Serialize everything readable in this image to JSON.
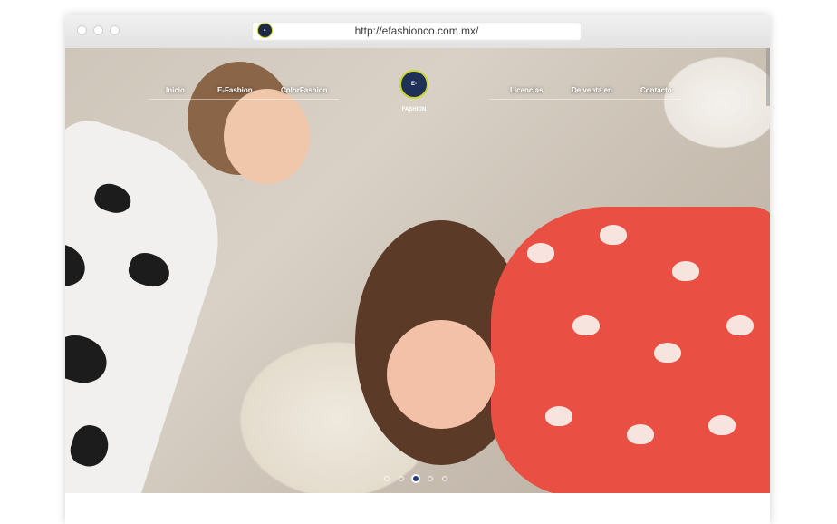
{
  "browser": {
    "url": "http://efashionco.com.mx/",
    "favicon_text": "E-FASHION"
  },
  "nav": {
    "left_items": [
      {
        "label": "Inicio"
      },
      {
        "label": "E-Fashion"
      },
      {
        "label": "ColorFashion"
      }
    ],
    "logo_text": "E-FASHION",
    "right_items": [
      {
        "label": "Licencias"
      },
      {
        "label": "De venta en"
      },
      {
        "label": "Contacto"
      }
    ]
  },
  "slider": {
    "slide_count": 5,
    "active_index": 2
  },
  "colors": {
    "logo_bg": "#1e2f58",
    "logo_ring": "#c9d62a",
    "active_dot": "#1f3e7a"
  }
}
